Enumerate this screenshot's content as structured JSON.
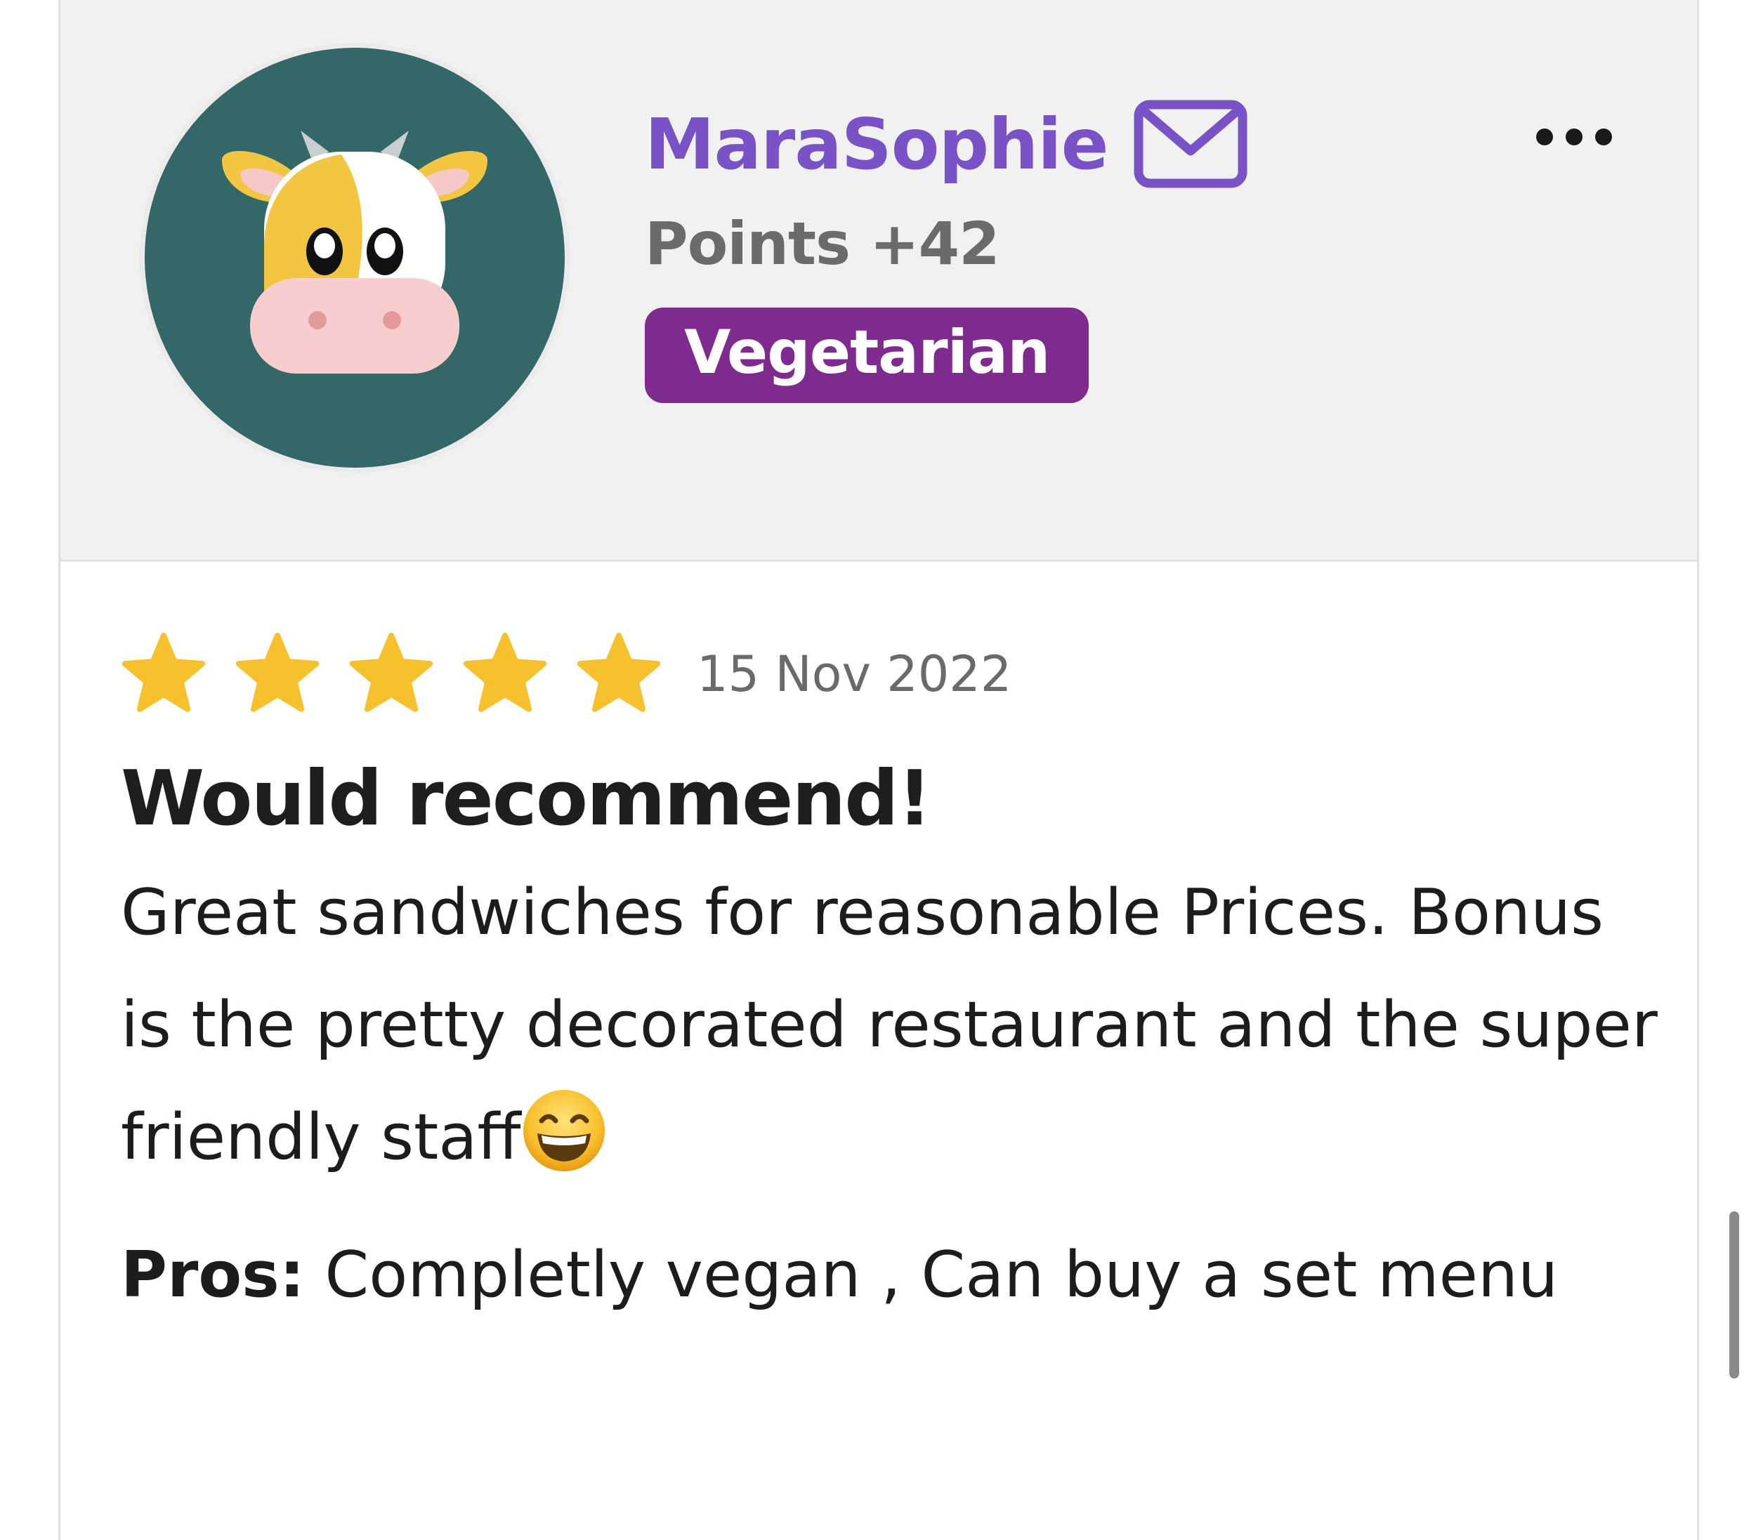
{
  "user": {
    "name": "MaraSophie",
    "points": "Points +42",
    "badge": "Vegetarian",
    "avatar_icon": "cow-avatar-icon",
    "name_color": "#7a52c7",
    "badge_color": "#7e2a8e"
  },
  "review": {
    "rating": 5,
    "rating_max": 5,
    "date": "15 Nov 2022",
    "title": "Would recommend!",
    "text": "Great sandwiches for reasonable Prices. Bonus is the pretty decorated restaurant and the super friendly staff",
    "emoji": "😄",
    "pros_label": "Pros:",
    "pros_text": "Completly vegan , Can buy a set menu",
    "star_color": "#f7c12e"
  }
}
